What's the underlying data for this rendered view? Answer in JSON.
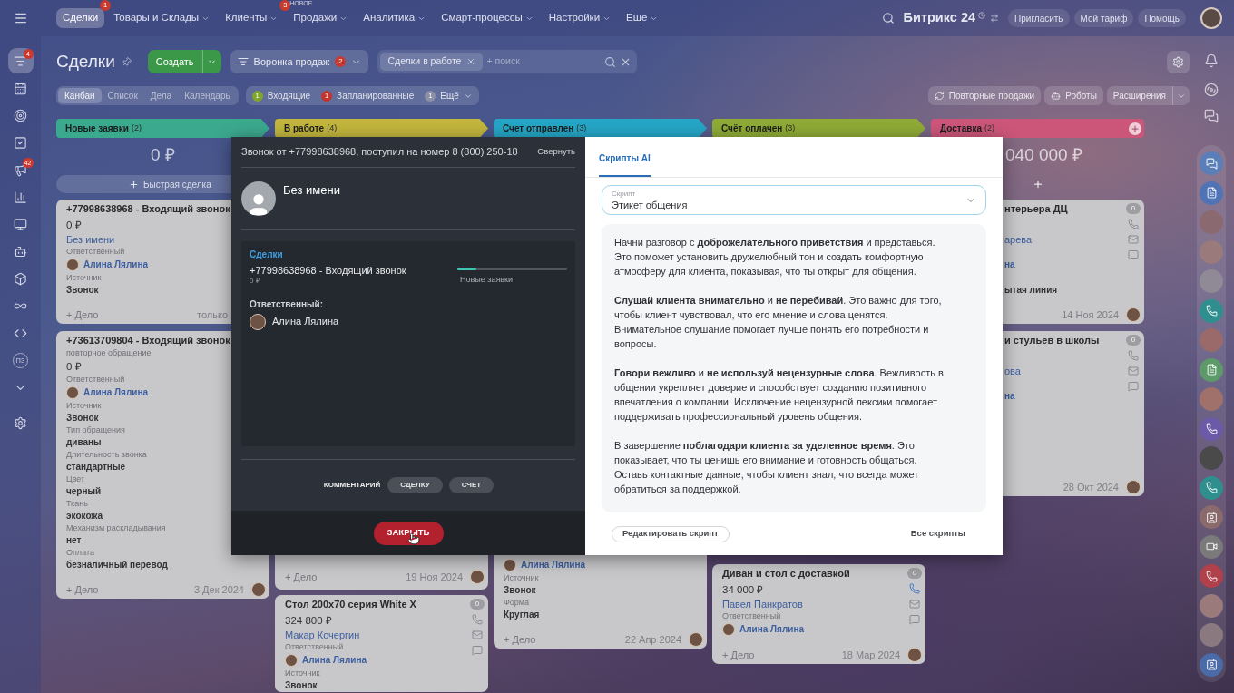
{
  "top_nav": {
    "items": [
      {
        "label": "Сделки",
        "selected": true,
        "badge": "1",
        "dropdown": false
      },
      {
        "label": "Товары и Склады",
        "selected": false,
        "dropdown": true
      },
      {
        "label": "Клиенты",
        "selected": false,
        "badge": "3",
        "dropdown": true
      },
      {
        "label": "Продажи",
        "selected": false,
        "tag": "НОВОЕ",
        "dropdown": true
      },
      {
        "label": "Аналитика",
        "selected": false,
        "dropdown": true
      },
      {
        "label": "Смарт-процессы",
        "selected": false,
        "dropdown": true
      },
      {
        "label": "Настройки",
        "selected": false,
        "dropdown": true
      },
      {
        "label": "Еще",
        "selected": false,
        "dropdown": true
      }
    ],
    "brand": "Битрикс 24",
    "links": [
      "Пригласить",
      "Мой тариф",
      "Помощь"
    ]
  },
  "sidebar": {
    "items": [
      {
        "selected": true,
        "badge": "4"
      },
      {
        "selected": false
      },
      {
        "selected": false
      },
      {
        "selected": false
      },
      {
        "selected": false,
        "badge": "42"
      },
      {
        "selected": false
      },
      {
        "selected": false
      },
      {
        "selected": false
      },
      {
        "selected": false
      },
      {
        "selected": false
      },
      {
        "selected": false
      },
      {
        "selected": false,
        "label": "ПЗ"
      },
      {
        "selected": false
      },
      {
        "selected": false
      }
    ]
  },
  "header": {
    "title": "Сделки",
    "create_button": "Создать",
    "pipeline": {
      "label": "Воронка продаж",
      "badge": "2"
    },
    "search": {
      "tags": [
        "Сделки в работе"
      ],
      "placeholder": "+ поиск"
    }
  },
  "view_tabs": [
    {
      "label": "Канбан",
      "selected": true
    },
    {
      "label": "Список",
      "selected": false
    },
    {
      "label": "Дела",
      "selected": false
    },
    {
      "label": "Календарь",
      "selected": false
    }
  ],
  "counters": [
    {
      "count": "1",
      "label": "Входящие",
      "color": "#7fa52c",
      "dropdown": false
    },
    {
      "count": "1",
      "label": "Запланированные",
      "color": "#c2352d",
      "dropdown": false
    },
    {
      "count": "1",
      "label": "Ещё",
      "color": "#8b90a6",
      "dropdown": true
    }
  ],
  "tools": [
    {
      "label": "Повторные продажи",
      "dropdown": false
    },
    {
      "label": "Роботы",
      "dropdown": false
    },
    {
      "label": "Расширения",
      "dropdown": true
    }
  ],
  "columns": [
    {
      "title": "Новые заявки",
      "count": "(2)",
      "color": "#3ba98e",
      "sum": "0 ₽",
      "quick_deal": true,
      "quick_deal_label": "Быстрая сделка",
      "add_stage": false,
      "cards": [
        {
          "title": "+77998638968 - Входящий звонок",
          "price": "0 ₽",
          "contact": "Без имени",
          "fields": [
            {
              "kind": "person",
              "label": "Ответственный",
              "value": "Алина Лялина"
            },
            {
              "kind": "text",
              "label": "Источник",
              "value": "Звонок"
            }
          ],
          "add_task": "+ Дело",
          "date": "только",
          "owner_avatar": false
        },
        {
          "title": "+73613709804 - Входящий звонок",
          "note": "повторное обращение",
          "price": "0 ₽",
          "fields": [
            {
              "kind": "person",
              "label": "Ответственный",
              "value": "Алина Лялина"
            },
            {
              "kind": "text",
              "label": "Источник",
              "value": "Звонок"
            },
            {
              "kind": "text",
              "label": "Тип обращения",
              "value": "диваны"
            },
            {
              "kind": "text",
              "label": "Длительность звонка",
              "value": "стандартные"
            },
            {
              "kind": "text",
              "label": "Цвет",
              "value": "черный"
            },
            {
              "kind": "text",
              "label": "Ткань",
              "value": "экокожа"
            },
            {
              "kind": "text",
              "label": "Механизм раскладывания",
              "value": "нет"
            },
            {
              "kind": "text",
              "label": "Оплата",
              "value": "безналичный перевод"
            }
          ],
          "add_task": "+ Дело",
          "date": "3 Дек 2024",
          "owner_avatar": true
        }
      ]
    },
    {
      "title": "В работе",
      "count": "(4)",
      "color": "#c2b63c",
      "quick_deal": false,
      "add_stage": false,
      "cards": [
        {
          "add_task": "+ Дело",
          "date": "19 Ноя 2024",
          "owner_avatar": true
        },
        {
          "title": "Стол 200x70 серия White X",
          "badge": "0",
          "price": "324 800 ₽",
          "contact": "Макар Кочергин",
          "fields": [
            {
              "kind": "person",
              "label": "Ответственный",
              "value": "Алина Лялина"
            },
            {
              "kind": "text",
              "label": "Источник",
              "value": "Звонок"
            }
          ],
          "phone_active": false
        }
      ]
    },
    {
      "title": "Счет отправлен",
      "count": "(3)",
      "color": "#25a6c6",
      "quick_deal": false,
      "add_stage": false,
      "cards": [
        {
          "fields": [
            {
              "kind": "person",
              "value": "Алина Лялина"
            },
            {
              "kind": "text",
              "label": "Источник",
              "value": "Звонок"
            },
            {
              "kind": "text",
              "label": "Форма",
              "value": "Круглая"
            }
          ],
          "add_task": "+ Дело",
          "date": "22 Апр 2024",
          "owner_avatar": true
        }
      ]
    },
    {
      "title": "Счёт оплачен",
      "count": "(3)",
      "color": "#8fab36",
      "quick_deal": false,
      "add_stage": false,
      "cards": [
        {
          "title": "Диван и стол с доставкой",
          "badge": "0",
          "price": "34 000 ₽",
          "contact": "Павел Панкратов",
          "fields": [
            {
              "kind": "person",
              "label": "Ответственный",
              "value": "Алина Лялина"
            }
          ],
          "add_task": "+ Дело",
          "date": "18 Мар 2024",
          "owner_avatar": true,
          "phone_active": true
        }
      ]
    },
    {
      "title": "Доставка",
      "count": "(2)",
      "color": "#cc5679",
      "sum": "040 000 ₽",
      "quick_deal": true,
      "add_stage": true,
      "cards": [
        {
          "title": "нтерьера ДЦ",
          "badge": "0",
          "contact": "арева",
          "fields": [
            {
              "kind": "name",
              "value": "на"
            },
            {
              "kind": "text",
              "value": "ытая линия"
            }
          ],
          "date": "14 Ноя 2024",
          "owner_avatar": true,
          "phone_active": false
        },
        {
          "title": "и стульев в школы",
          "badge": "0",
          "contact": "ова",
          "fields": [
            {
              "kind": "name",
              "value": "на"
            }
          ],
          "date": "28 Окт 2024",
          "owner_avatar": true,
          "phone_active": false
        }
      ]
    }
  ],
  "call_card": {
    "header": "Звонок от +77998638968, поступил на номер 8 (800) 250-18",
    "collapse": "Свернуть",
    "contact_name": "Без имени",
    "deals_label": "Сделки",
    "deal": {
      "title": "+77998638968 - Входящий звонок",
      "amount": "0 ₽",
      "stage": "Новые заявки",
      "level": 0.17
    },
    "responsible_label": "Ответственный:",
    "responsible": "Алина Лялина",
    "tabs": [
      {
        "label": "КОММЕНТАРИЙ",
        "selected": true
      },
      {
        "label": "СДЕЛКУ",
        "selected": false
      },
      {
        "label": "СЧЕТ",
        "selected": false
      }
    ],
    "close_button": "ЗАКРЫТЬ"
  },
  "scripts_panel": {
    "tabs": [
      {
        "label": "Скрипты AI",
        "selected": true
      }
    ],
    "select": {
      "label": "Скрипт",
      "value": "Этикет общения"
    },
    "paragraphs": [
      "Начни разговор с **доброжелательного приветствия** и представься. Это поможет установить дружелюбный тон и создать комфортную атмосферу для клиента, показывая, что ты открыт для общения.",
      "**Слушай клиента внимательно** и **не перебивай**. Это важно для того, чтобы клиент чувствовал, что его мнение и слова ценятся. Внимательное слушание помогает лучше понять его потребности и вопросы.",
      "**Говори вежливо** и **не используй нецензурные слова**. Вежливость в общении укрепляет доверие и способствует созданию позитивного впечатления о компании. Исключение нецензурной лексики помогает поддерживать профессиональный уровень общения.",
      "В завершение **поблагодари клиента за уделенное время**. Это показывает, что ты ценишь его внимание и готовность общаться. Оставь контактные данные, чтобы клиент знал, что всегда может обратиться за поддержкой."
    ],
    "edit_button": "Редактировать скрипт",
    "all_link": "Все скрипты"
  }
}
